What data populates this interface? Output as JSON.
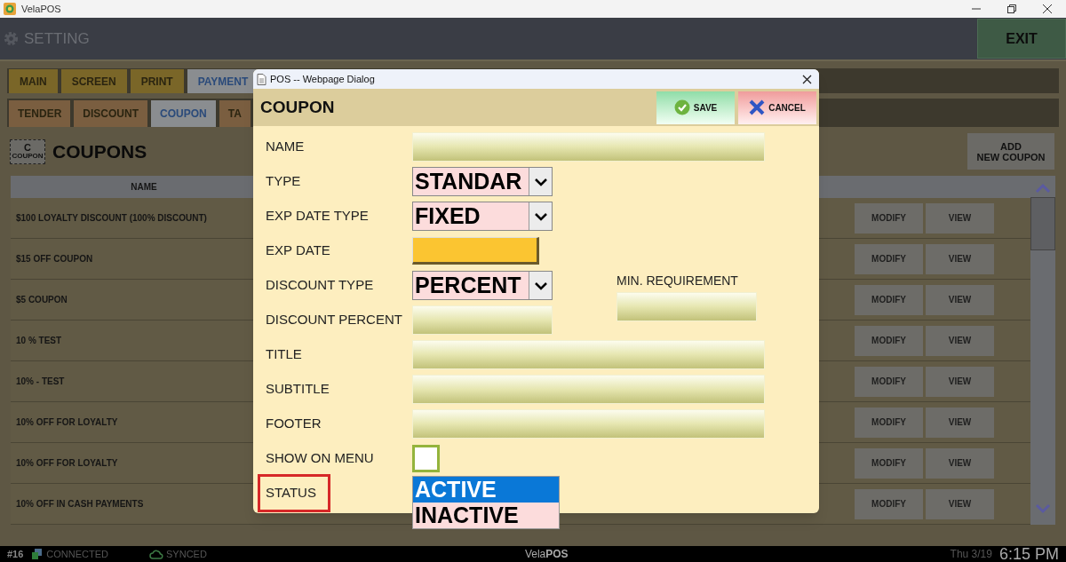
{
  "window": {
    "title": "VelaPOS"
  },
  "header": {
    "title": "SETTING",
    "exit_button": "EXIT"
  },
  "main_tabs": [
    {
      "label": "MAIN",
      "selected": false
    },
    {
      "label": "SCREEN",
      "selected": false
    },
    {
      "label": "PRINT",
      "selected": false
    },
    {
      "label": "PAYMENT",
      "selected": true
    }
  ],
  "sub_tabs": [
    {
      "label": "TENDER",
      "selected": false
    },
    {
      "label": "DISCOUNT",
      "selected": false
    },
    {
      "label": "COUPON",
      "selected": true
    },
    {
      "label": "TA",
      "selected": false
    }
  ],
  "page": {
    "title": "COUPONS",
    "icon_letter": "C",
    "icon_caption": "COUPON",
    "add_button": [
      "ADD",
      "NEW COUPON"
    ]
  },
  "table": {
    "columns": [
      "NAME"
    ],
    "rows": [
      {
        "name": "$100 LOYALTY DISCOUNT (100% DISCOUNT)",
        "actions": [
          "MODIFY",
          "VIEW"
        ]
      },
      {
        "name": "$15 OFF COUPON",
        "actions": [
          "MODIFY",
          "VIEW"
        ]
      },
      {
        "name": "$5 COUPON",
        "actions": [
          "MODIFY",
          "VIEW"
        ]
      },
      {
        "name": "10 % TEST",
        "actions": [
          "MODIFY",
          "VIEW"
        ]
      },
      {
        "name": "10% - TEST",
        "actions": [
          "MODIFY",
          "VIEW"
        ]
      },
      {
        "name": "10% OFF FOR LOYALTY",
        "actions": [
          "MODIFY",
          "VIEW"
        ]
      },
      {
        "name": "10% OFF FOR LOYALTY",
        "actions": [
          "MODIFY",
          "VIEW"
        ]
      },
      {
        "name": "10% OFF IN CASH PAYMENTS",
        "actions": [
          "MODIFY",
          "VIEW"
        ]
      }
    ]
  },
  "dialog": {
    "title": "POS -- Webpage Dialog",
    "heading": "COUPON",
    "buttons": [
      {
        "kind": "save",
        "label": "SAVE"
      },
      {
        "kind": "cancel",
        "label": "CANCEL"
      }
    ],
    "fields": [
      {
        "kind": "text",
        "label": "NAME"
      },
      {
        "kind": "select",
        "label": "TYPE",
        "value": "STANDAR"
      },
      {
        "kind": "select",
        "label": "EXP DATE TYPE",
        "value": "FIXED"
      },
      {
        "kind": "date",
        "label": "EXP DATE"
      },
      {
        "kind": "select",
        "label": "DISCOUNT TYPE",
        "value": "PERCENT"
      },
      {
        "kind": "short_text",
        "label": "DISCOUNT PERCENT"
      },
      {
        "kind": "text",
        "label": "TITLE"
      },
      {
        "kind": "text",
        "label": "SUBTITLE"
      },
      {
        "kind": "text",
        "label": "FOOTER"
      },
      {
        "kind": "checkbox",
        "label": "SHOW ON MENU",
        "checked": false
      },
      {
        "kind": "listbox",
        "label": "STATUS",
        "outlined": true,
        "options": [
          {
            "label": "ACTIVE",
            "selected": true
          },
          {
            "label": "INACTIVE",
            "selected": false
          }
        ]
      }
    ],
    "side_field": {
      "label": "MIN. REQUIREMENT"
    }
  },
  "status_bar": {
    "terminal": "#16",
    "connection": "CONNECTED",
    "sync": "SYNCED",
    "brand": "Vela**POS**",
    "date": "Thu 3/19",
    "time": "6:15 PM"
  }
}
